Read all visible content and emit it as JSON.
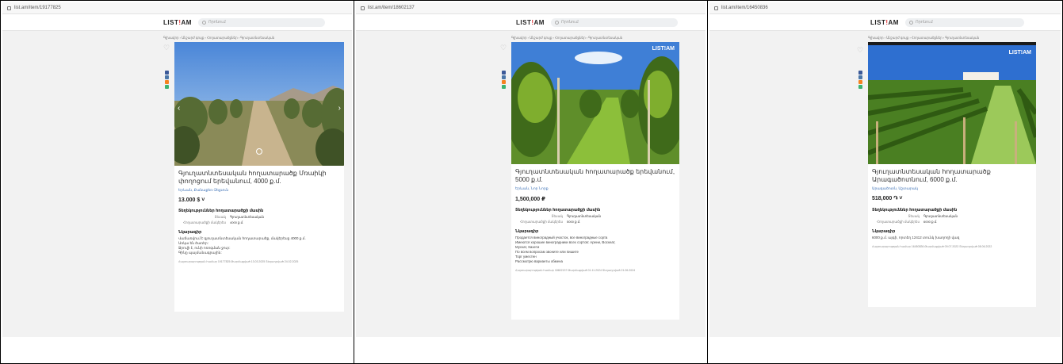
{
  "panels": [
    {
      "url": "list.am/item/19177825",
      "logo": "LIST",
      "logo_bang": "!",
      "logo_end": "AM",
      "search_placeholder": "Որոնում",
      "breadcrumb": "Գլխավոր › Անշարժ գույք › Հողատարածքներ › Գյուղատնտեսական",
      "title": "Գյուղատնտեսական հողատարածք Մռաիկի փողոցում երեվանում, 4000 ք.մ.",
      "location": "Երևան, Քանաքեռ-Զեյթուն",
      "price": "13.000 $ ˅",
      "details_heading": "Տեղեկություններ հողատարածքի մասին",
      "details": [
        {
          "k": "Տեսակ",
          "v": "Գյուղատնտեսական"
        },
        {
          "k": "Հողատարածքի մակերես",
          "v": "4000 ք.մ."
        }
      ],
      "desc_heading": "Նկարագիր",
      "desc_lines": [
        "Վաճառվում է գյուղատնտեսական հողատարածք, մակերեսը 4000 ք.մ.",
        "Առկա են ծառեր:",
        "Ջրովի է, ունի ոռոգման ջուր:",
        "Գինը պայմանագրային:"
      ],
      "meta": "Հայտարարության համար 19177825   Թարմացված 13.03.2025   Տեղադրված 24.02.2025"
    },
    {
      "url": "list.am/item/18602137",
      "logo": "LIST",
      "logo_bang": "!",
      "logo_end": "AM",
      "search_placeholder": "Որոնում",
      "breadcrumb": "Գլխավոր › Անշարժ գույք › Հողատարածքներ › Գյուղատնտեսական",
      "title": "Գյուղատնտեսական հողատարածք երեվանում, 5000 ք.մ.",
      "location": "Երևան, Նոր Նորք",
      "price": "1,500,000 ₽",
      "details_heading": "Տեղեկություններ հողատարածքի մասին",
      "details": [
        {
          "k": "Տեսակ",
          "v": "Գյուղատնտեսական"
        },
        {
          "k": "Հողատարածքի մակերես",
          "v": "5000 ք.մ."
        }
      ],
      "desc_heading": "Նկարագիր",
      "desc_lines": [
        "Продается виноградный участок, все виноградные сорта",
        "Имеются хорошие виноградники всех сортов: Арени, Воскеат,",
        "Мускат, Кахети",
        "По всем вопросам звоните или пишите",
        "Торг уместен",
        "Рассмотрю варианты обмена"
      ],
      "meta": "Հայտարարության համար 18602137   Թարմացված 01.11.2024   Տեղադրված 21.06.2024"
    },
    {
      "url": "list.am/item/16450836",
      "logo": "LIST",
      "logo_bang": "!",
      "logo_end": "AM",
      "search_placeholder": "Որոնում",
      "breadcrumb": "Գլխավոր › Անշարժ գույք › Հողատարածքներ › Գյուղատնտեսական",
      "title": "Գյուղատնտեսական հողատարածք Արագածոտնում, 6000 ք.մ.",
      "location": "Արագածոտն, Աշտարակ",
      "price": "518,000 ֏ ˅",
      "details_heading": "Տեղեկություններ հողատարածքի մասին",
      "details": [
        {
          "k": "Տեսակ",
          "v": "Գյուղատնտեսական"
        },
        {
          "k": "Հողատարածքի մակերես",
          "v": "6000 ք.մ."
        }
      ],
      "desc_heading": "Նկարագիր",
      "desc_lines": [
        "6000 ք.մ. այգի, որտեղ 12412 տունկ խաղողի վազ"
      ],
      "meta": "Հայտարարության համար 16450836   Թարմացված 09.07.2023   Տեղադրված 08.06.2022"
    }
  ],
  "colors": {
    "logo_accent": "#e4393c",
    "link": "#3a6fb5",
    "social": [
      "#3b5998",
      "#4a76a8",
      "#f58220",
      "#3cb371"
    ]
  }
}
